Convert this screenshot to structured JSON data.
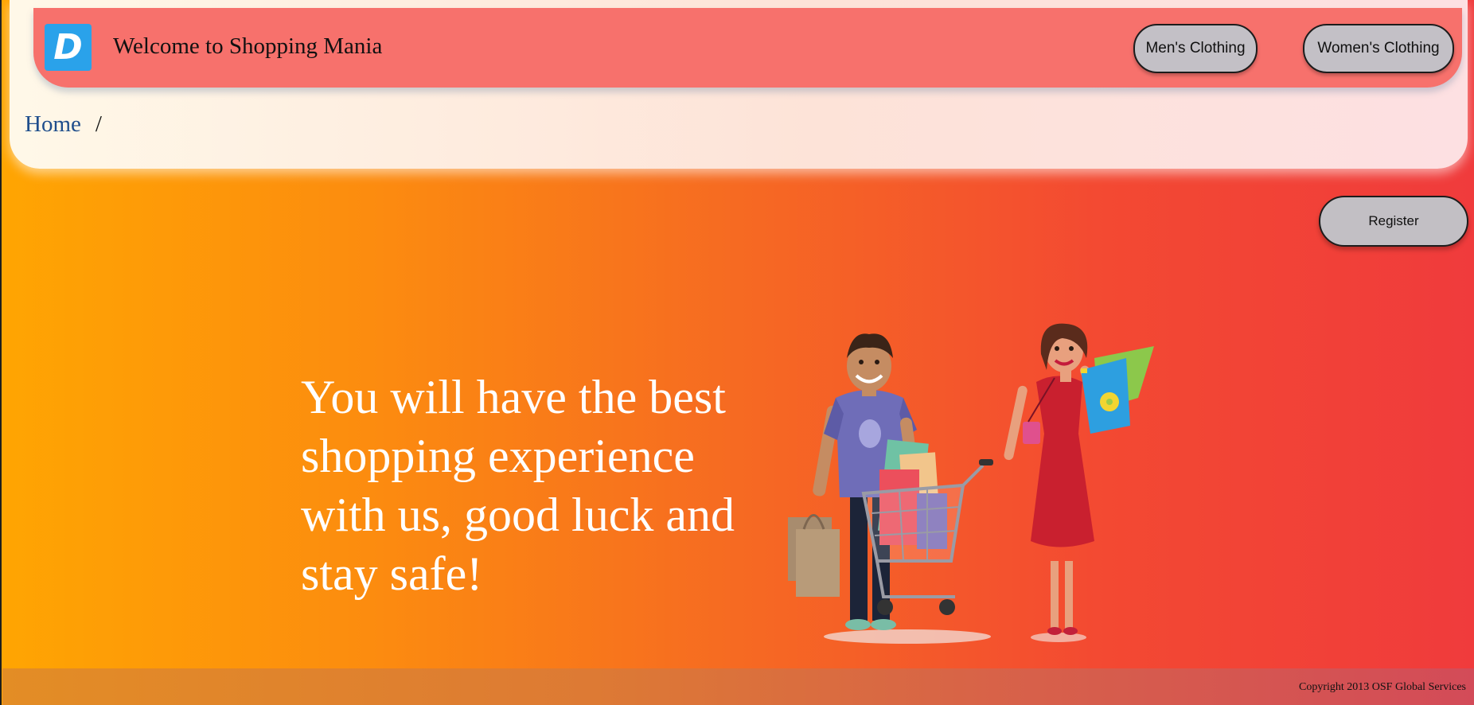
{
  "navbar": {
    "logo_letter": "D",
    "title": "Welcome to Shopping Mania",
    "links": [
      "Men's Clothing",
      "Women's Clothing"
    ]
  },
  "breadcrumb": {
    "home": "Home",
    "separator": "/"
  },
  "register_label": "Register",
  "hero": {
    "tagline": "You will have the best shopping experience with us, good luck and stay safe!"
  },
  "footer": {
    "copyright": "Copyright 2013 OSF Global Services"
  },
  "colors": {
    "background_gradient": [
      "#ffa502",
      "#f03b3c"
    ],
    "navbar": "#f7716c",
    "logo": "#2aa2ea",
    "button": "#c3c0c6",
    "breadcrumb_link": "#1f4e8c"
  },
  "icons": {
    "logo": "d-logo-icon",
    "illustration": "shopping-couple-illustration"
  }
}
